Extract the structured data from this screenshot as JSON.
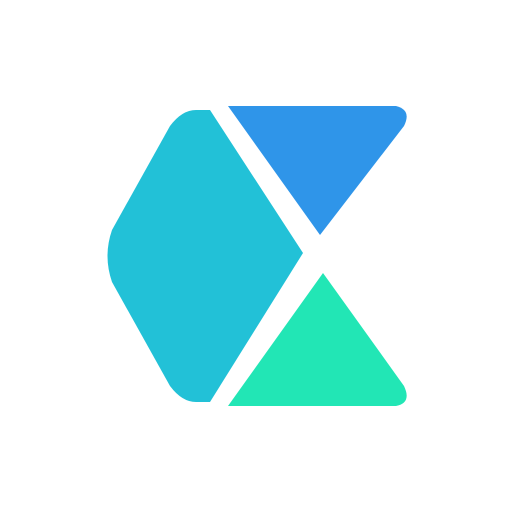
{
  "logo": {
    "name": "app-logo",
    "colors": {
      "background": "#ffffff",
      "cyan_hexagon": "#22C1D7",
      "blue_triangle": "#2F95E9",
      "green_triangle": "#22E6B5"
    }
  }
}
